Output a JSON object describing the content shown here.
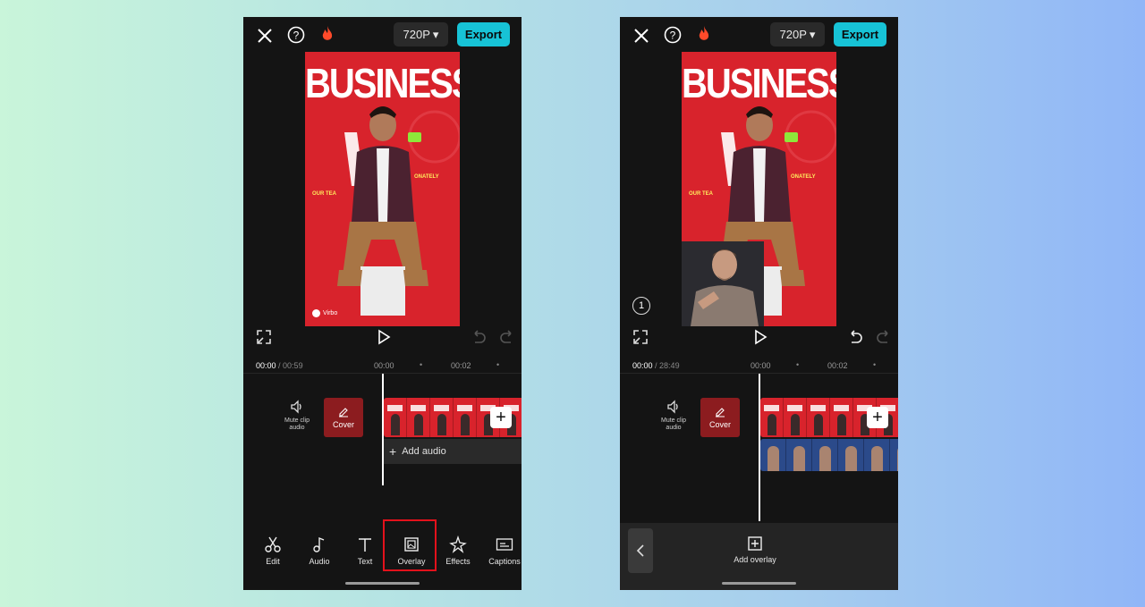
{
  "colors": {
    "accent": "#17c3d6",
    "highlight": "#e3111b",
    "preview_bg": "#d8232c"
  },
  "screens": [
    {
      "id": "left",
      "resolution": "720P",
      "export_label": "Export",
      "preview": {
        "title": "BUSINESS",
        "side_text_left": "OUR TEA",
        "side_text_right": "ONATELY",
        "brand": "Virbo"
      },
      "timeline": {
        "current_time": "00:00",
        "total_time": "/ 00:59",
        "ticks": [
          "00:00",
          "00:02"
        ],
        "mute_label": "Mute clip audio",
        "cover_label": "Cover",
        "add_audio_label": "Add audio"
      },
      "toolbar": [
        {
          "label": "Edit",
          "icon": "scissors-icon"
        },
        {
          "label": "Audio",
          "icon": "music-note-icon"
        },
        {
          "label": "Text",
          "icon": "text-icon"
        },
        {
          "label": "Overlay",
          "icon": "overlay-icon",
          "highlighted": true
        },
        {
          "label": "Effects",
          "icon": "effects-star-icon"
        },
        {
          "label": "Captions",
          "icon": "captions-icon"
        }
      ]
    },
    {
      "id": "right",
      "resolution": "720P",
      "export_label": "Export",
      "preview": {
        "title": "BUSINESS",
        "side_text_left": "OUR TEA",
        "side_text_right": "ONATELY",
        "overlay_badge": "1"
      },
      "timeline": {
        "current_time": "00:00",
        "total_time": "/ 28:49",
        "ticks": [
          "00:00",
          "00:02"
        ],
        "mute_label": "Mute clip audio",
        "cover_label": "Cover"
      },
      "bottom_panel": {
        "add_overlay_label": "Add overlay"
      }
    }
  ]
}
